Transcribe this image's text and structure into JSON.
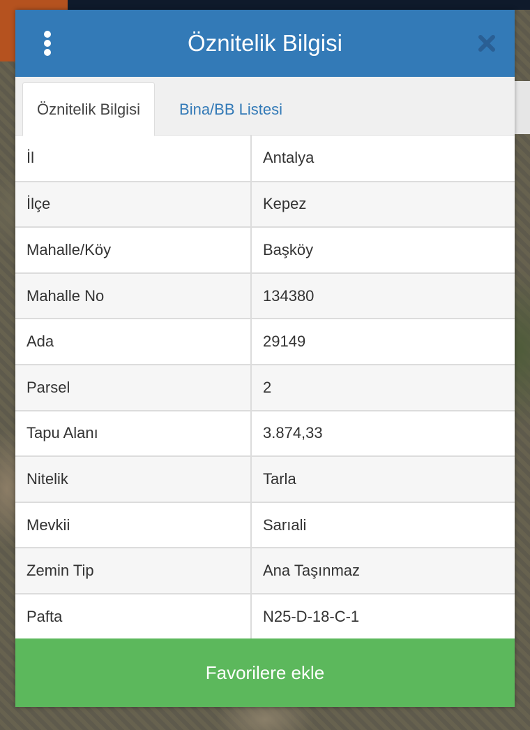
{
  "header": {
    "title": "Öznitelik Bilgisi",
    "menu_icon": "kebab-vertical-icon",
    "close_icon": "close-icon"
  },
  "tabs": [
    {
      "label": "Öznitelik Bilgisi",
      "active": true
    },
    {
      "label": "Bina/BB Listesi",
      "active": false
    }
  ],
  "attributes": [
    {
      "key": "İl",
      "value": "Antalya"
    },
    {
      "key": "İlçe",
      "value": "Kepez"
    },
    {
      "key": "Mahalle/Köy",
      "value": "Başköy"
    },
    {
      "key": "Mahalle No",
      "value": "134380"
    },
    {
      "key": "Ada",
      "value": "29149"
    },
    {
      "key": "Parsel",
      "value": "2"
    },
    {
      "key": "Tapu Alanı",
      "value": "3.874,33"
    },
    {
      "key": "Nitelik",
      "value": "Tarla"
    },
    {
      "key": "Mevkii",
      "value": "Sarıali"
    },
    {
      "key": "Zemin Tip",
      "value": "Ana Taşınmaz"
    },
    {
      "key": "Pafta",
      "value": "N25-D-18-C-1"
    }
  ],
  "footer": {
    "favorite_label": "Favorilere ekle"
  },
  "colors": {
    "header": "#337ab7",
    "favorite_button": "#5cb85c",
    "tab_link": "#337ab7"
  }
}
